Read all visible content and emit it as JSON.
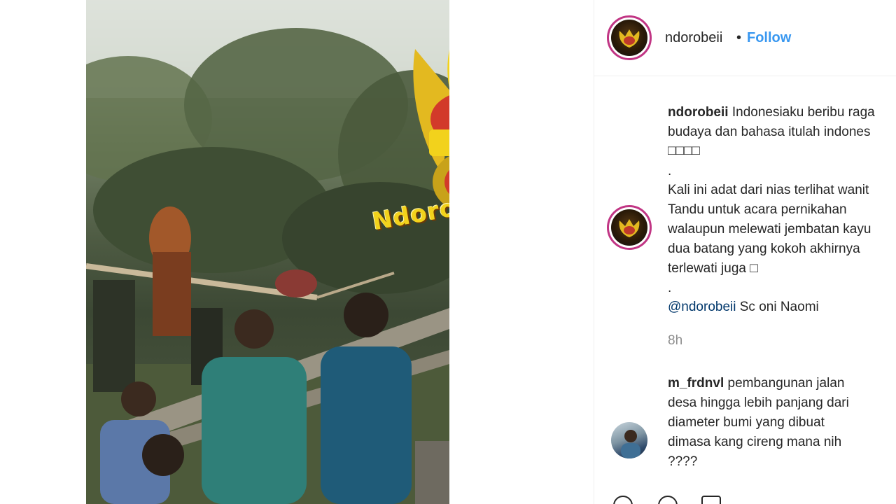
{
  "post": {
    "account": "ndorobeii",
    "follow_separator": "•",
    "follow_label": "Follow",
    "watermark": "NdoroBeii",
    "caption_user": "ndorobeii",
    "caption_lines": [
      "Indonesiaku beribu raga",
      "budaya dan bahasa itulah indones",
      "□□□□",
      ".",
      "Kali ini adat dari nias terlihat wanit",
      "Tandu untuk acara pernikahan",
      "walaupun melewati jembatan kayu",
      "dua batang yang kokoh akhirnya",
      "terlewati juga □",
      "."
    ],
    "mention": "@ndorobeii",
    "credit": " Sc oni Naomi",
    "time_ago": "8h"
  },
  "comments": [
    {
      "user": "m_frdnvl",
      "lines": [
        "pembangunan jalan",
        "desa hingga lebih panjang dari",
        "diameter bumi yang dibuat",
        "dimasa kang cireng mana nih",
        "????"
      ]
    }
  ],
  "icons": {
    "account_avatar": "eagle-crest-logo",
    "commenter_avatar": "person-photo",
    "actions": [
      "heart-icon",
      "comment-icon",
      "share-icon"
    ]
  },
  "colors": {
    "follow": "#3897f0",
    "mention": "#00376b",
    "meta": "#8e8e8e",
    "avatar_ring": "#c13584"
  }
}
